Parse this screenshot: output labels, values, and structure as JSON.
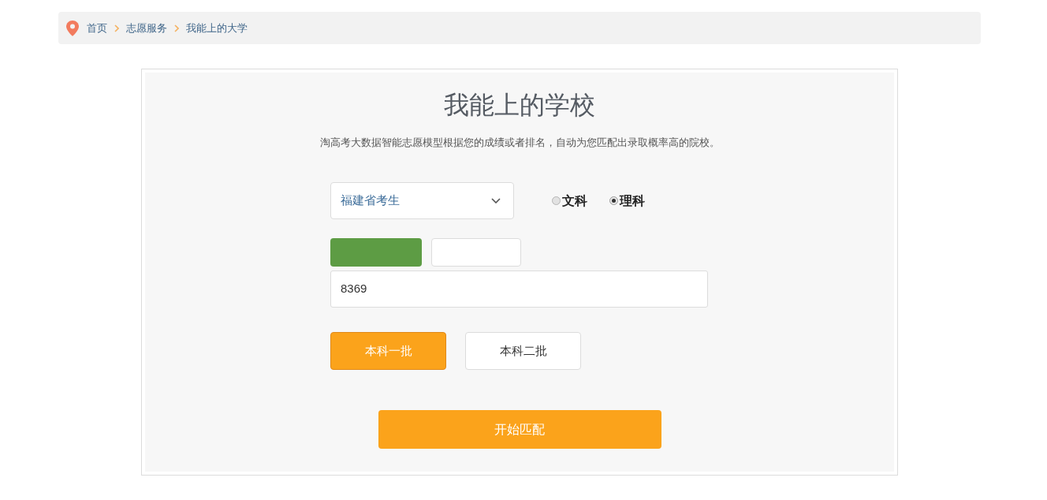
{
  "breadcrumb": {
    "items": [
      {
        "label": "首页"
      },
      {
        "label": "志愿服务"
      },
      {
        "label": "我能上的大学"
      }
    ]
  },
  "panel": {
    "title": "我能上的学校",
    "description": "淘高考大数据智能志愿模型根据您的成绩或者排名，自动为您匹配出录取概率高的院校。"
  },
  "province_select": {
    "value": "福建省考生"
  },
  "subject_radios": [
    {
      "label": "文科",
      "selected": false
    },
    {
      "label": "理科",
      "selected": true
    }
  ],
  "mode_tabs": [
    {
      "selected": true
    },
    {
      "selected": false
    }
  ],
  "score_input": {
    "value": "8369"
  },
  "batch_buttons": [
    {
      "label": "本科一批",
      "selected": true
    },
    {
      "label": "本科二批",
      "selected": false
    }
  ],
  "submit_button": {
    "label": "开始匹配"
  }
}
